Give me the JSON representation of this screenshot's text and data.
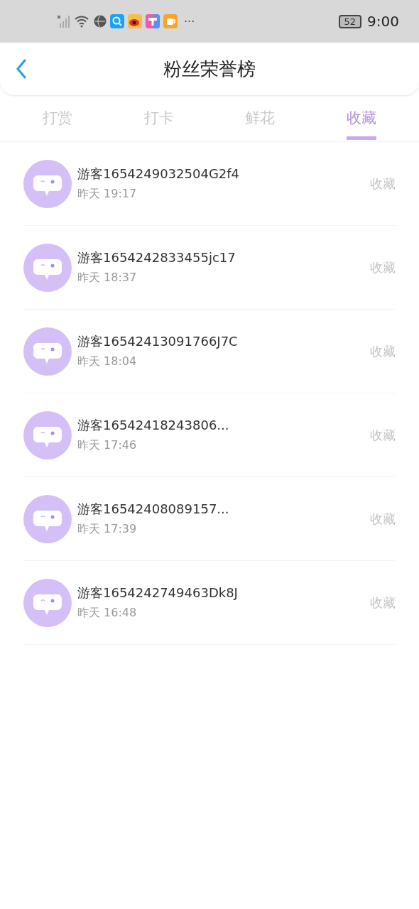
{
  "status_bar": {
    "more": "···",
    "battery": "52",
    "time": "9:00"
  },
  "header": {
    "title": "粉丝荣誉榜"
  },
  "tabs": [
    {
      "label": "打赏",
      "selected": false
    },
    {
      "label": "打卡",
      "selected": false
    },
    {
      "label": "鲜花",
      "selected": false
    },
    {
      "label": "收藏",
      "selected": true
    }
  ],
  "fans": [
    {
      "name": "游客1654249032504G2f4",
      "time": "昨天 19:17",
      "action": "收藏"
    },
    {
      "name": "游客1654242833455jc17",
      "time": "昨天 18:37",
      "action": "收藏"
    },
    {
      "name": "游客16542413091766J7C",
      "time": "昨天 18:04",
      "action": "收藏"
    },
    {
      "name": "游客16542418243806...",
      "time": "昨天 17:46",
      "action": "收藏"
    },
    {
      "name": "游客16542408089157...",
      "time": "昨天 17:39",
      "action": "收藏"
    },
    {
      "name": "游客1654242749463Dk8J",
      "time": "昨天 16:48",
      "action": "收藏"
    }
  ]
}
